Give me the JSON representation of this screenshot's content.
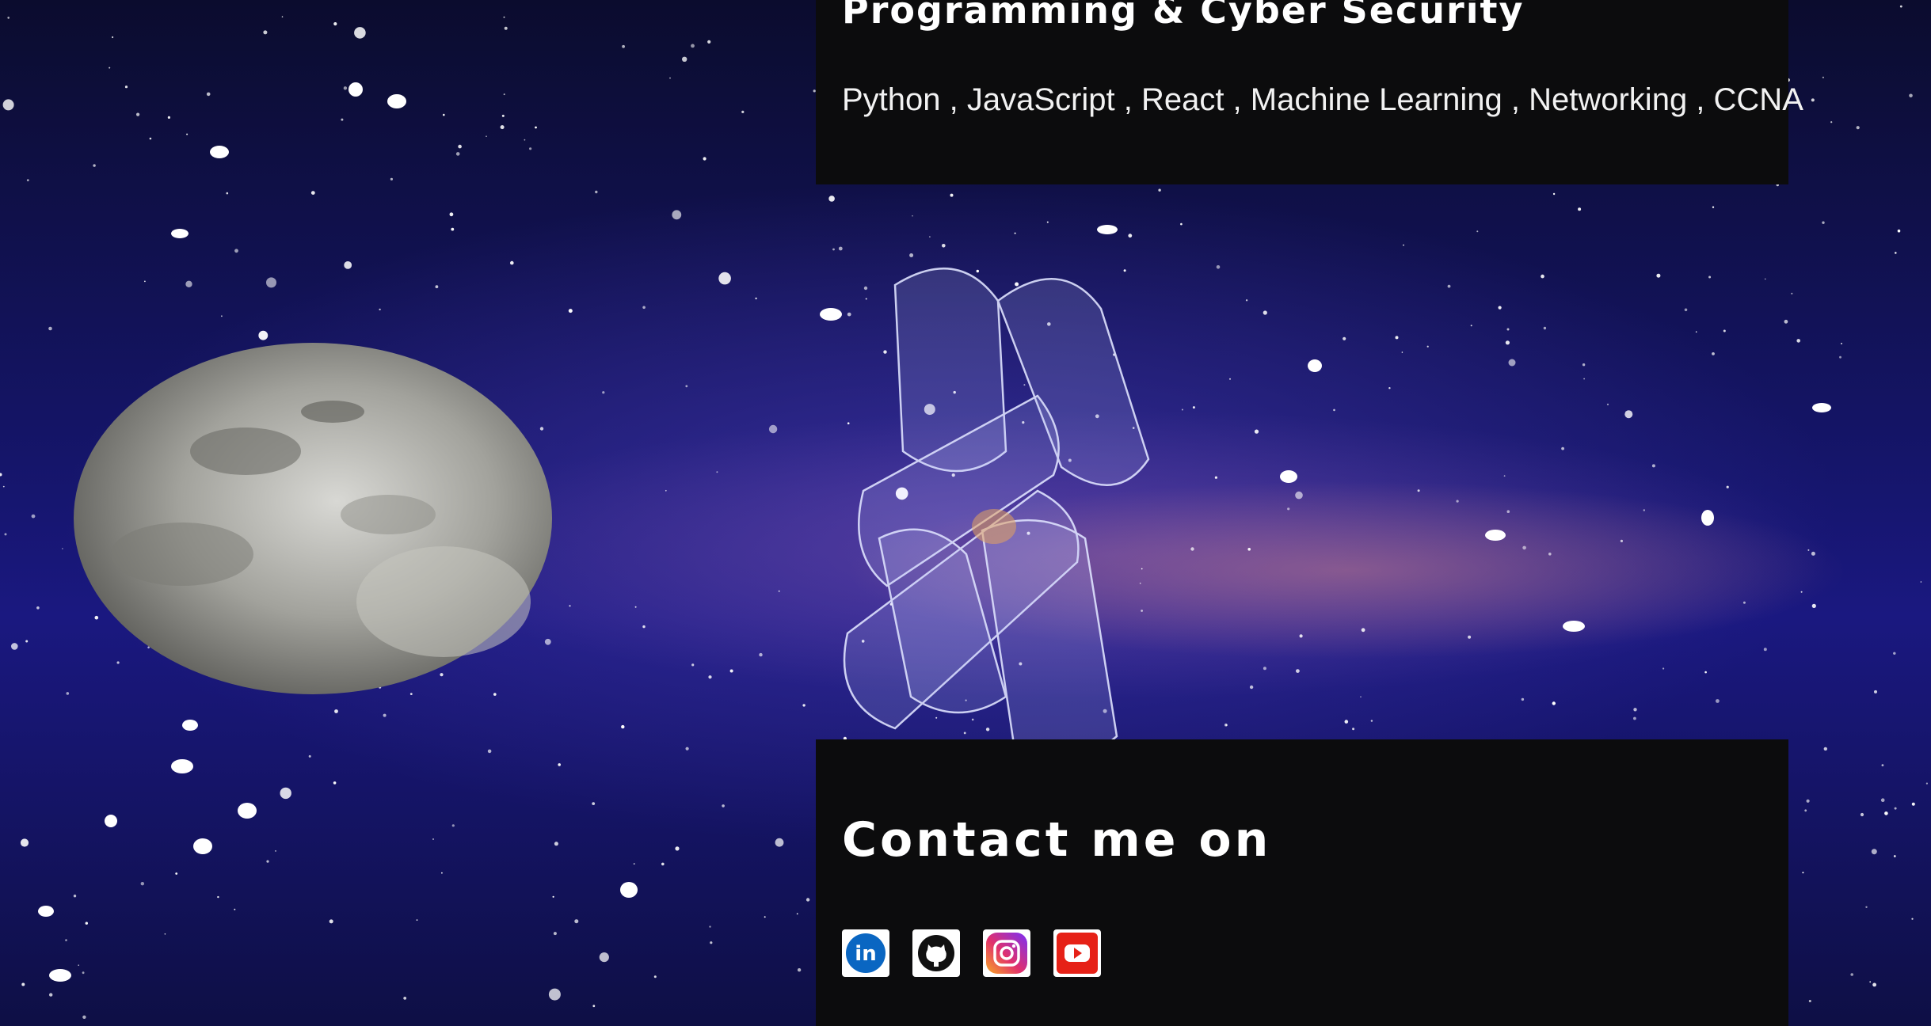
{
  "skills_panel": {
    "heading": "Programming & Cyber Security",
    "skills": "Python , JavaScript , React , Machine Learning , Networking , CCNA"
  },
  "contact_panel": {
    "heading": "Contact me on",
    "social_links": [
      {
        "icon": "linkedin-icon",
        "text": "in"
      },
      {
        "icon": "github-icon"
      },
      {
        "icon": "instagram-icon"
      },
      {
        "icon": "youtube-icon"
      }
    ]
  },
  "colors": {
    "panel_background": "#0c0c0d",
    "text": "#ffffff",
    "linkedin": "#0a66c2",
    "youtube": "#e62117"
  }
}
